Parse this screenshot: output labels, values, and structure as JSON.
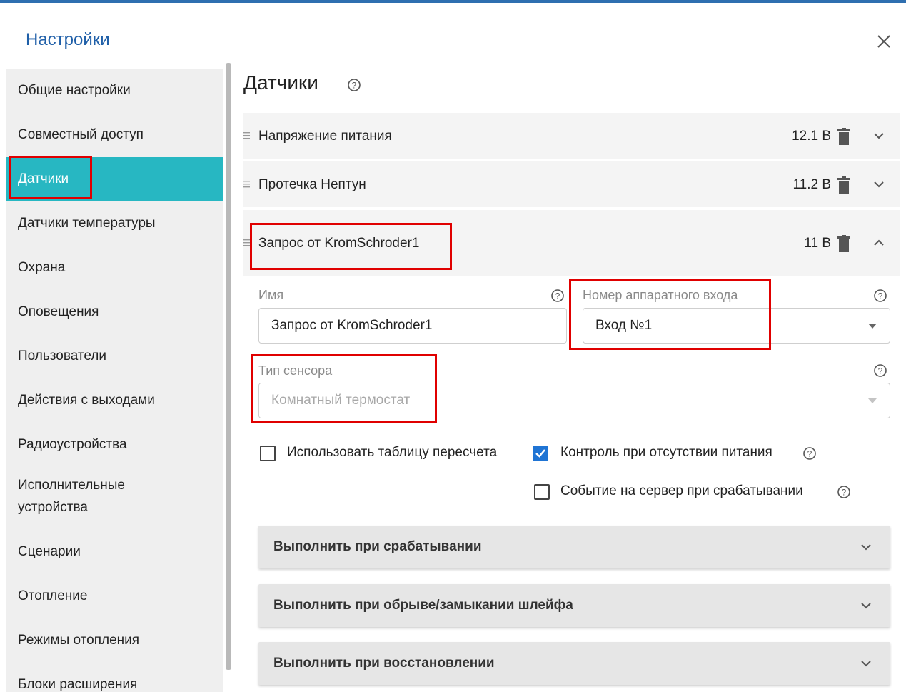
{
  "dialog": {
    "title": "Настройки"
  },
  "sidebar": {
    "items": [
      {
        "label": "Общие настройки"
      },
      {
        "label": "Совместный доступ"
      },
      {
        "label": "Датчики"
      },
      {
        "label": "Датчики температуры"
      },
      {
        "label": "Охрана"
      },
      {
        "label": "Оповещения"
      },
      {
        "label": "Пользователи"
      },
      {
        "label": "Действия с выходами"
      },
      {
        "label": "Радиоустройства"
      },
      {
        "label": "Исполнительные",
        "label2": "устройства"
      },
      {
        "label": "Сценарии"
      },
      {
        "label": "Отопление"
      },
      {
        "label": "Режимы отопления"
      },
      {
        "label": "Блоки расширения"
      }
    ],
    "active_index": 2
  },
  "main": {
    "title": "Датчики",
    "sensors": [
      {
        "name": "Напряжение питания",
        "value": "12.1 В"
      },
      {
        "name": "Протечка Нептун",
        "value": "11.2 В"
      },
      {
        "name": "Запрос от KromSchroder1",
        "value": "11 В"
      }
    ],
    "form": {
      "name_label": "Имя",
      "name_value": "Запрос от KromSchroder1",
      "input_label": "Номер аппаратного входа",
      "input_value": "Вход №1",
      "sensor_type_label": "Тип сенсора",
      "sensor_type_value": "Комнатный термостат",
      "checkbox_recalc": {
        "label": "Использовать таблицу пересчета",
        "checked": false
      },
      "checkbox_power": {
        "label": "Контроль при отсутствии питания",
        "checked": true
      },
      "checkbox_event": {
        "label": "Событие на сервер при срабатывании",
        "checked": false
      }
    },
    "actions": [
      {
        "label": "Выполнить при срабатывании"
      },
      {
        "label": "Выполнить при обрыве/замыкании шлейфа"
      },
      {
        "label": "Выполнить при восстановлении"
      }
    ]
  },
  "colors": {
    "accent": "#27b7c2",
    "title_blue": "#1f5fa8",
    "highlight_red": "#e00000",
    "checkbox_blue": "#1f74d4"
  }
}
